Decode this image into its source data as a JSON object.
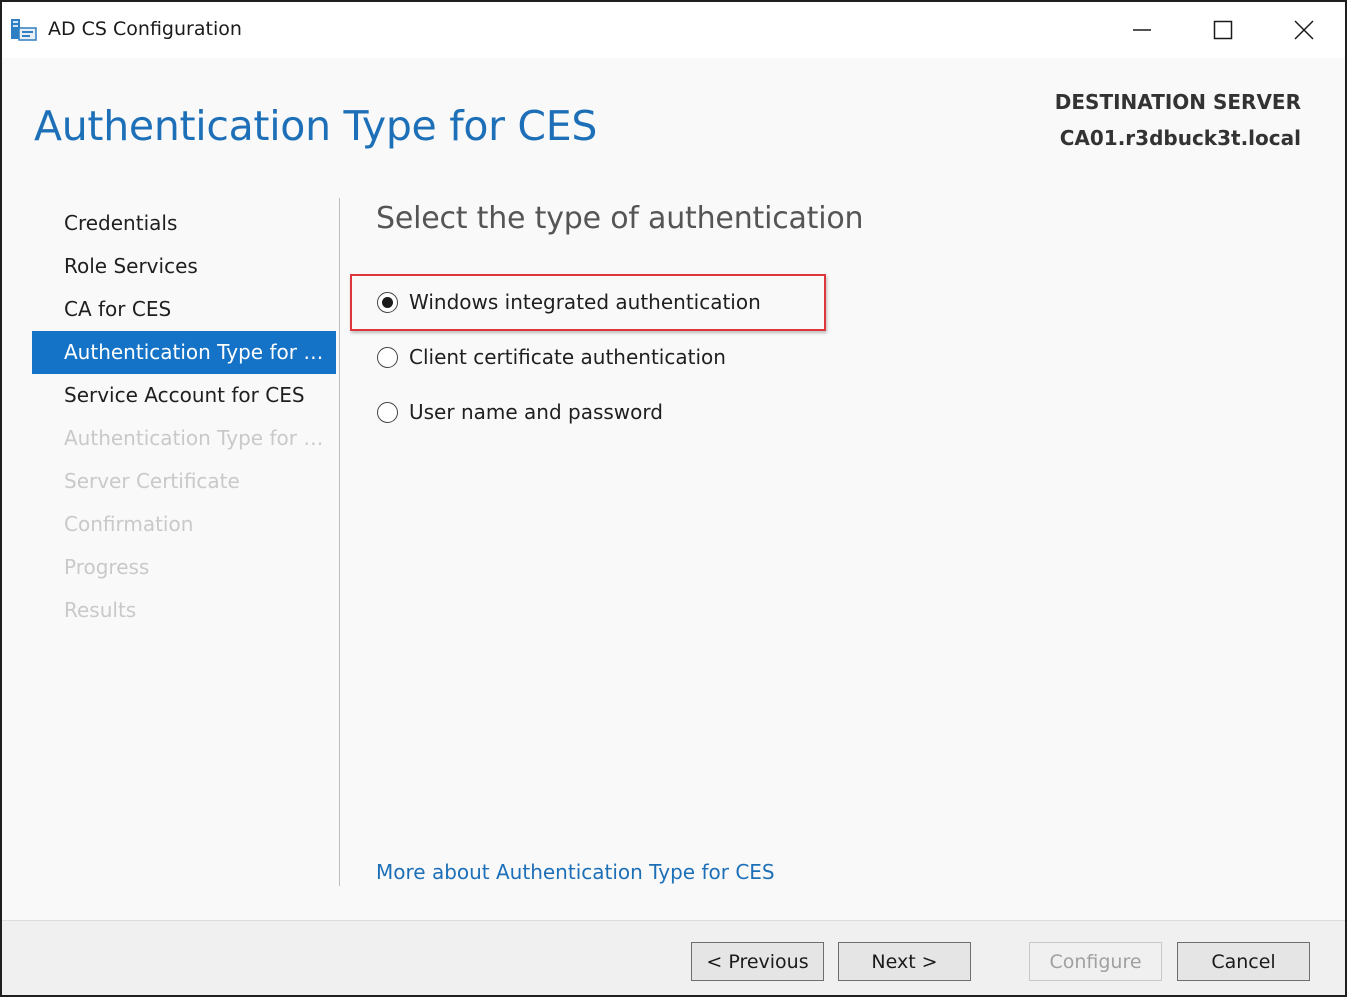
{
  "window": {
    "title": "AD CS Configuration",
    "icon": "server-manager-icon"
  },
  "header": {
    "page_title": "Authentication Type for CES",
    "destination_label": "DESTINATION SERVER",
    "destination_server": "CA01.r3dbuck3t.local"
  },
  "nav": {
    "items": [
      {
        "label": "Credentials",
        "state": "normal"
      },
      {
        "label": "Role Services",
        "state": "normal"
      },
      {
        "label": "CA for CES",
        "state": "normal"
      },
      {
        "label": "Authentication Type for C...",
        "state": "active"
      },
      {
        "label": "Service Account for CES",
        "state": "normal"
      },
      {
        "label": "Authentication Type for C...",
        "state": "disabled"
      },
      {
        "label": "Server Certificate",
        "state": "disabled"
      },
      {
        "label": "Confirmation",
        "state": "disabled"
      },
      {
        "label": "Progress",
        "state": "disabled"
      },
      {
        "label": "Results",
        "state": "disabled"
      }
    ]
  },
  "main": {
    "heading": "Select the type of authentication",
    "options": [
      {
        "label": "Windows integrated authentication",
        "selected": true
      },
      {
        "label": "Client certificate authentication",
        "selected": false
      },
      {
        "label": "User name and password",
        "selected": false
      }
    ],
    "more_link": "More about Authentication Type for CES"
  },
  "footer": {
    "previous_label": "< Previous",
    "next_label": "Next >",
    "configure_label": "Configure",
    "cancel_label": "Cancel"
  },
  "colors": {
    "accent": "#1d70b8",
    "nav_active_bg": "#1573c7",
    "highlight_border": "#e0353b"
  }
}
